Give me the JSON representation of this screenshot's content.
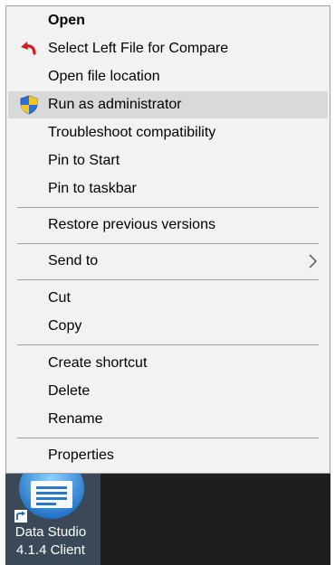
{
  "context_menu": {
    "items": [
      {
        "label": "Open"
      },
      {
        "label": "Select Left File for Compare",
        "icon": "undo-arrow-icon",
        "icon_color": "#cc1f1f"
      },
      {
        "label": "Open file location"
      },
      {
        "label": "Run as administrator",
        "icon": "uac-shield-icon",
        "highlighted": true
      },
      {
        "label": "Troubleshoot compatibility"
      },
      {
        "label": "Pin to Start"
      },
      {
        "label": "Pin to taskbar"
      },
      {
        "label": "Restore previous versions"
      },
      {
        "label": "Send to",
        "icon": "chevron-right-icon",
        "submenu": true
      },
      {
        "label": "Cut"
      },
      {
        "label": "Copy"
      },
      {
        "label": "Create shortcut"
      },
      {
        "label": "Delete"
      },
      {
        "label": "Rename"
      },
      {
        "label": "Properties"
      }
    ]
  },
  "desktop_icon": {
    "label_line1": "Data Studio",
    "label_line2": "4.1.4 Client",
    "icon": "data-studio-app-icon",
    "overlay_icon": "shortcut-arrow-icon"
  },
  "colors": {
    "menu_background": "#f2f2f2",
    "highlight": "#d9d9d9",
    "separator": "#a0a0a0",
    "desktop": "#1e1e1e",
    "tile": "#3a4858"
  }
}
